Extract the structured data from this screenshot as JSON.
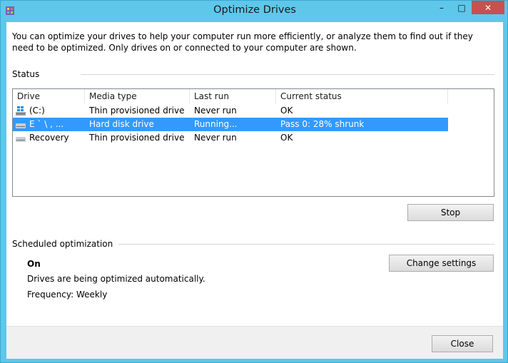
{
  "window": {
    "title": "Optimize Drives",
    "controls": {
      "minimize": "–",
      "maximize": "□",
      "close": "✕"
    }
  },
  "intro": "You can optimize your drives to help your computer run more efficiently, or analyze them to find out if they need to be optimized. Only drives on or connected to your computer are shown.",
  "status": {
    "label": "Status",
    "columns": [
      "Drive",
      "Media type",
      "Last run",
      "Current status"
    ],
    "rows": [
      {
        "drive": "(C:)",
        "media_type": "Thin provisioned drive",
        "last_run": "Never run",
        "current_status": "OK",
        "icon": "windows-drive-icon",
        "selected": false
      },
      {
        "drive": "E ` \\ ,   ...",
        "media_type": "Hard disk drive",
        "last_run": "Running...",
        "current_status": "Pass 0: 28% shrunk",
        "icon": "hard-disk-icon",
        "selected": true
      },
      {
        "drive": "Recovery",
        "media_type": "Thin provisioned drive",
        "last_run": "Never run",
        "current_status": "OK",
        "icon": "hard-disk-icon",
        "selected": false
      }
    ],
    "stop_button": "Stop"
  },
  "scheduled": {
    "label": "Scheduled optimization",
    "state": "On",
    "description": "Drives are being optimized automatically.",
    "frequency": "Frequency: Weekly",
    "change_settings_button": "Change settings"
  },
  "footer": {
    "close_button": "Close"
  },
  "colors": {
    "frame": "#5fc7ea",
    "selection": "#3399ff",
    "close_control": "#c75050"
  }
}
